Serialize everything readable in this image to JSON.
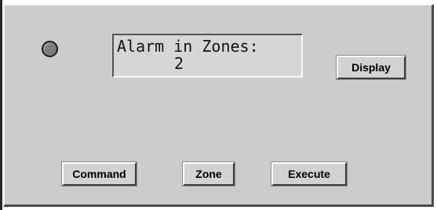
{
  "status_led": {
    "icon": "status-led-icon",
    "color": "#7b7b7b"
  },
  "display": {
    "line1": "Alarm in Zones:",
    "line2": "2"
  },
  "buttons": {
    "display": "Display",
    "command": "Command",
    "zone": "Zone",
    "execute": "Execute"
  }
}
